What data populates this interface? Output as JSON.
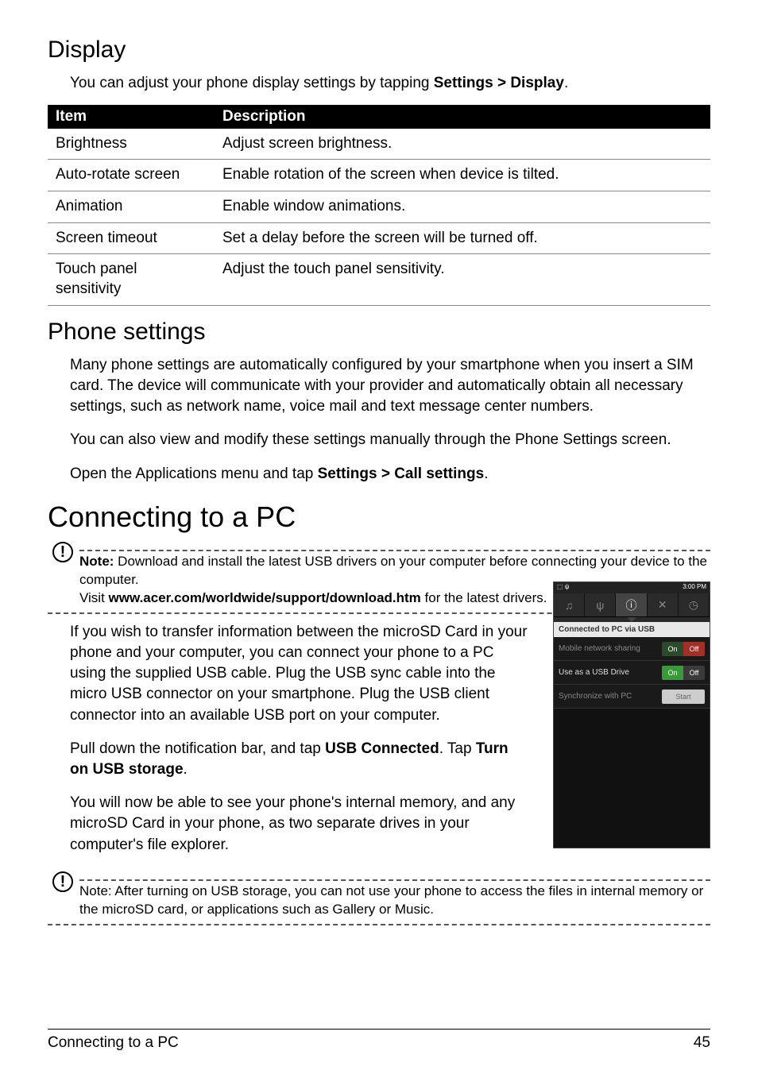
{
  "section1": {
    "title": "Display",
    "intro_pre": "You can adjust your phone display settings by tapping ",
    "intro_bold": "Settings > Display",
    "intro_post": "."
  },
  "table": {
    "head_item": "Item",
    "head_desc": "Description",
    "rows": [
      {
        "item": "Brightness",
        "desc": "Adjust screen brightness."
      },
      {
        "item": "Auto-rotate screen",
        "desc": "Enable rotation of the screen when device is tilted."
      },
      {
        "item": "Animation",
        "desc": "Enable window animations."
      },
      {
        "item": "Screen timeout",
        "desc": "Set a delay before the screen will be turned off."
      },
      {
        "item": "Touch panel sensitivity",
        "desc": "Adjust the touch panel sensitivity."
      }
    ]
  },
  "section2": {
    "title": "Phone settings",
    "p1": "Many phone settings are automatically configured by your smartphone when you insert a SIM card. The device will communicate with your provider and automatically obtain all necessary settings, such as network name, voice mail and text message center numbers.",
    "p2": "You can also view and modify these settings manually through the Phone Settings screen.",
    "p3_pre": "Open the Applications menu and tap ",
    "p3_bold": "Settings > Call settings",
    "p3_post": "."
  },
  "section3": {
    "title": "Connecting to a PC",
    "note1": {
      "lead": "Note:",
      "body": " Download and install the latest USB drivers on your computer before connecting your device to the computer.",
      "visit_pre": "Visit ",
      "visit_bold": "www.acer.com/worldwide/support/download.htm",
      "visit_post": " for the latest drivers."
    },
    "p1": "If you wish to transfer information between the microSD Card in your phone and your computer, you can connect your phone to a PC using the supplied USB cable. Plug the USB sync cable into the micro USB connector on your smartphone. Plug the USB client connector into an available USB port on your computer.",
    "p2_pre": "Pull down the notification bar, and tap ",
    "p2_b1": "USB Connected",
    "p2_mid": ". Tap ",
    "p2_b2": "Turn on USB storage",
    "p2_post": ".",
    "p3": "You will now be able to see your phone's internal memory, and any microSD Card in your phone, as two separate drives in your computer's file explorer.",
    "note2": "Note: After turning on USB storage, you can not use your phone to access the files in internal memory or the microSD card, or applications such as Gallery or Music."
  },
  "screenshot": {
    "status_time": "3:00 PM",
    "header": "Connected to PC via USB",
    "row1_label": "Mobile network sharing",
    "row1_on": "On",
    "row1_off": "Off",
    "row2_label": "Use as a USB Drive",
    "row2_on": "On",
    "row2_off": "Off",
    "row3_label": "Synchronize with PC",
    "row3_btn": "Start"
  },
  "footer": {
    "left": "Connecting to a PC",
    "right": "45"
  }
}
